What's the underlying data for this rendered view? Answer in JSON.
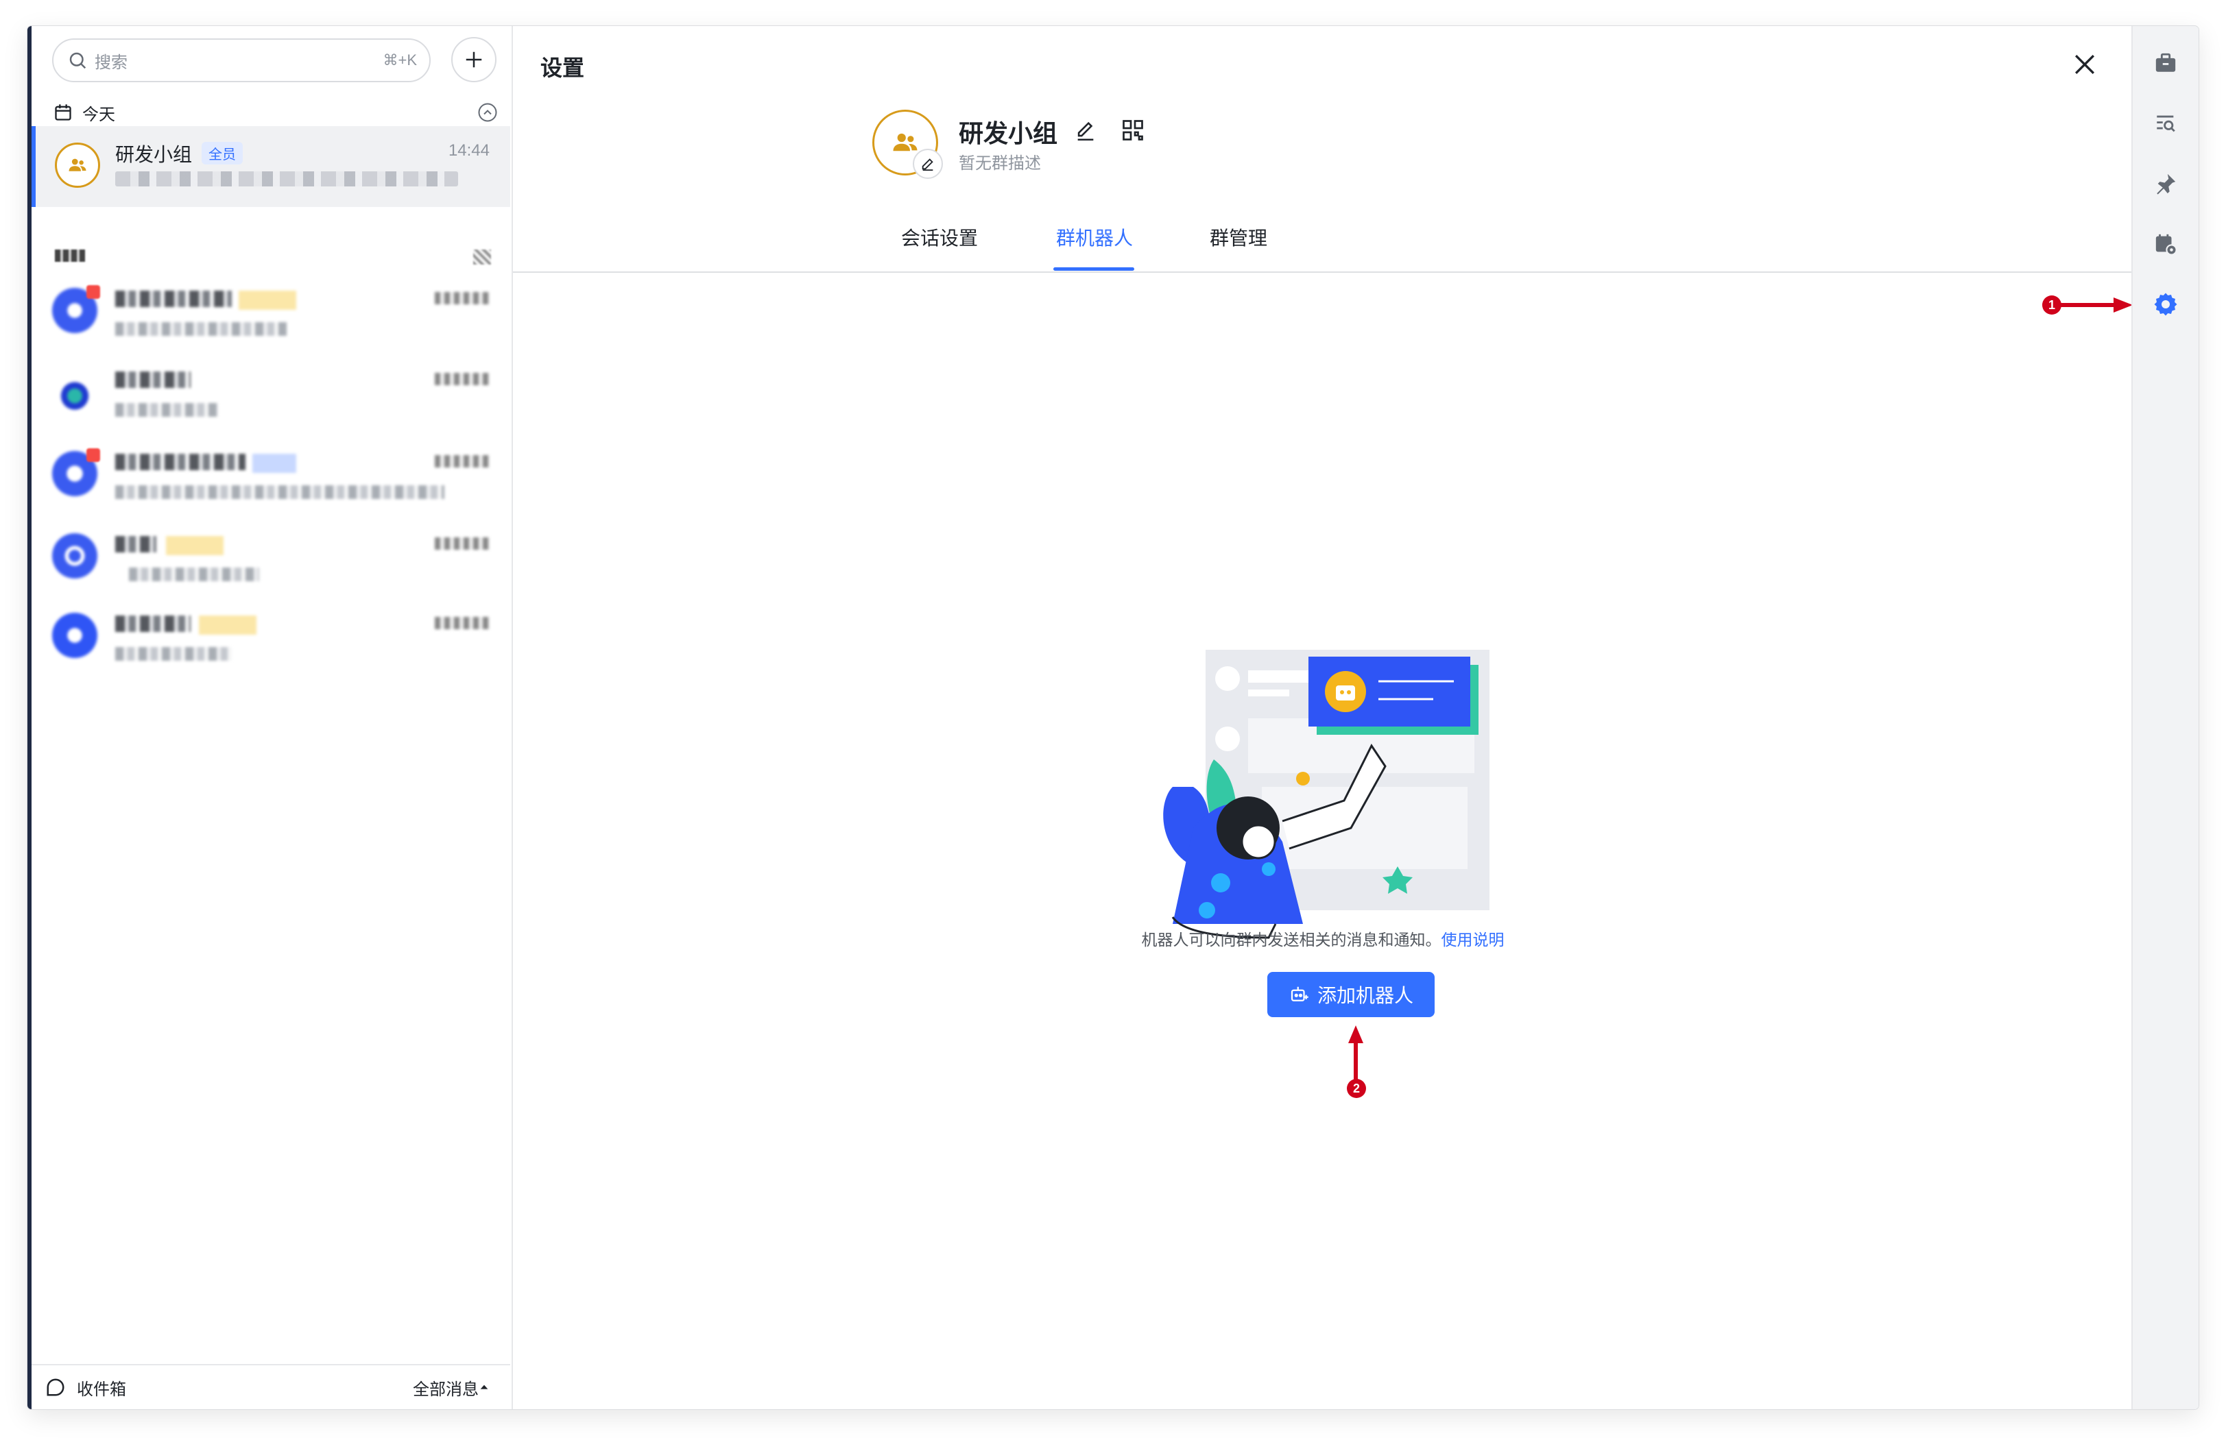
{
  "sidebar": {
    "search_placeholder": "搜索",
    "search_shortcut": "⌘+K",
    "section_today": "今天",
    "active_conversation": {
      "title": "研发小组",
      "tag": "全员",
      "time": "14:44"
    },
    "footer": {
      "inbox": "收件箱",
      "filter": "全部消息"
    }
  },
  "panel": {
    "title": "设置",
    "group_name": "研发小组",
    "group_description": "暂无群描述",
    "tabs": [
      {
        "label": "会话设置"
      },
      {
        "label": "群机器人"
      },
      {
        "label": "群管理"
      }
    ],
    "hint_text": "机器人可以向群内发送相关的消息和通知。",
    "hint_link": "使用说明",
    "add_bot_label": "添加机器人"
  },
  "annotations": [
    {
      "number": "1"
    },
    {
      "number": "2"
    }
  ],
  "colors": {
    "accent": "#3370ff",
    "group_avatar_ring": "#d79b1b",
    "annotation": "#d0021b",
    "rail_bg": "#f2f3f5"
  },
  "icons": {
    "rail": [
      "briefcase-icon",
      "search-list-icon",
      "pin-icon",
      "calendar-settings-icon",
      "gear-icon"
    ]
  }
}
